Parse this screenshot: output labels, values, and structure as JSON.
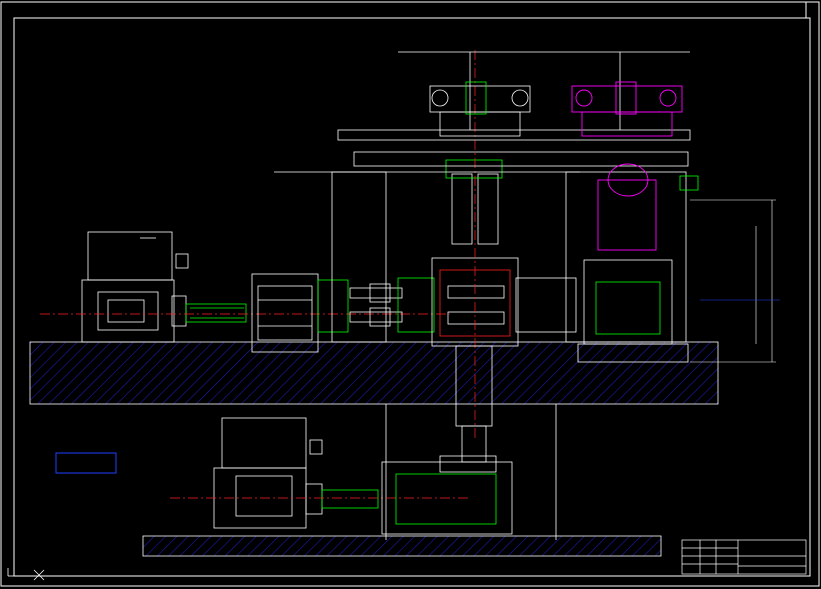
{
  "drawing": {
    "background": "#000000",
    "colors": {
      "white": "#ffffff",
      "red": "#ff2020",
      "green": "#00ff00",
      "magenta": "#ff00ff",
      "blue": "#2020ff",
      "yellow": "#ffff00",
      "cyan": "#00ffff",
      "hatch": "#1010a0"
    },
    "icons": [
      "ucs-icon",
      "title-block"
    ]
  }
}
